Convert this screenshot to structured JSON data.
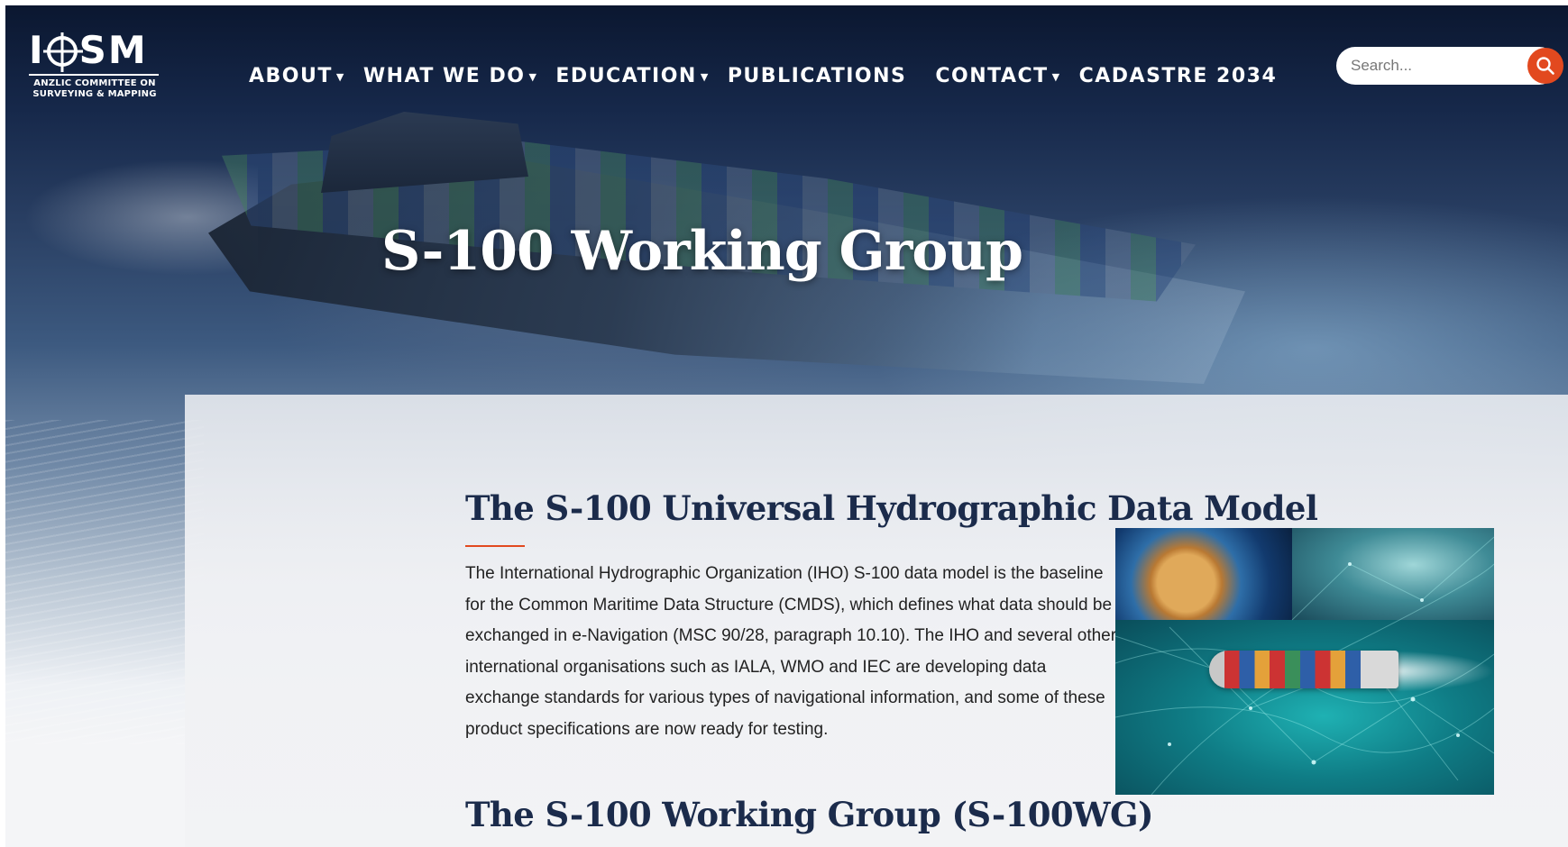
{
  "logo": {
    "mark": "ICSM",
    "subtitle_line1": "ANZLIC COMMITTEE ON",
    "subtitle_line2": "SURVEYING & MAPPING"
  },
  "nav": {
    "items": [
      {
        "label": "ABOUT",
        "has_dropdown": true
      },
      {
        "label": "WHAT WE DO",
        "has_dropdown": true
      },
      {
        "label": "EDUCATION",
        "has_dropdown": true
      },
      {
        "label": "PUBLICATIONS",
        "has_dropdown": false
      },
      {
        "label": "CONTACT",
        "has_dropdown": true
      },
      {
        "label": "CADASTRE 2034",
        "has_dropdown": false
      }
    ],
    "caret": "▼"
  },
  "search": {
    "placeholder": "Search...",
    "value": "",
    "icon": "search-icon"
  },
  "hero": {
    "title": "S-100 Working Group"
  },
  "content": {
    "section1_title": "The S-100 Universal Hydrographic Data Model",
    "section1_body": "The International Hydrographic Organization (IHO) S-100 data model is the baseline for the Common Maritime Data Structure (CMDS), which defines what data should be exchanged in e-Navigation (MSC 90/28, paragraph 10.10). The IHO and several other international organisations such as IALA, WMO and IEC are developing data exchange standards for various types of navigational information, and some of these product specifications are now ready for testing.",
    "section2_title": "The S-100 Working Group (S-100WG)"
  },
  "colors": {
    "accent": "#e2491f",
    "heading": "#1b2b4b",
    "hero_dark": "#0b1730"
  }
}
